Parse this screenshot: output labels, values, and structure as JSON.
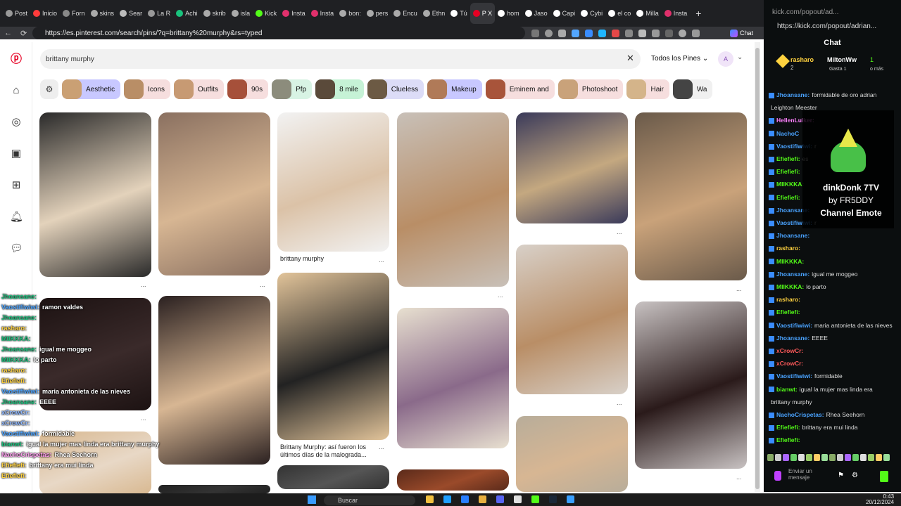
{
  "browser": {
    "tabs": [
      "Post",
      "Inicio",
      "Forn",
      "skins",
      "Sear",
      "La R",
      "Achi",
      "skrib",
      "isla",
      "Kick",
      "Insta",
      "Insta",
      "bon:",
      "pers",
      "Encu",
      "Ethn",
      "Tú",
      "P X",
      "hom",
      "Jaso",
      "Capi",
      "Cybi",
      "el co",
      "Milla",
      "Insta"
    ],
    "active_tab_index": 17,
    "url": "https://es.pinterest.com/search/pins/?q=brittany%20murphy&rs=typed",
    "chat_label": "Chat"
  },
  "pinterest": {
    "search_value": "brittany murphy",
    "all_pins_label": "Todos los Pines",
    "avatar_letter": "A",
    "filters": [
      "Aesthetic",
      "Icons",
      "Outfits",
      "90s",
      "Pfp",
      "8 mile",
      "Clueless",
      "Makeup",
      "Eminem and",
      "Photoshoot",
      "Hair",
      "Wa"
    ],
    "pin_labels": {
      "col3_pin1": "brittany murphy",
      "col3_pin2_line1": "Brittany Murphy: así fueron los",
      "col3_pin2_line2": "últimos días de la malograda..."
    },
    "dots": "..."
  },
  "overlay_chat": [
    {
      "user": "Jhoansane:",
      "text": ""
    },
    {
      "user": "Vaostifiwiwi:",
      "text": "ramon valdes"
    },
    {
      "user": "Jhoansane:",
      "text": ""
    },
    {
      "user": "rasharo:",
      "text": ""
    },
    {
      "user": "MIIKKKA:",
      "text": ""
    },
    {
      "user": "Jhoansane:",
      "text": "igual me moggeo"
    },
    {
      "user": "MIIKKKA:",
      "text": "lo parto"
    },
    {
      "user": "rasharo:",
      "text": ""
    },
    {
      "user": "Efiefiefi:",
      "text": ""
    },
    {
      "user": "Vaostifiwiwi:",
      "text": "maria antonieta de las nieves"
    },
    {
      "user": "Jhoansane:",
      "text": "EEEE"
    },
    {
      "user": "xCrowCr:",
      "text": ""
    },
    {
      "user": "xCrowCr:",
      "text": ""
    },
    {
      "user": "Vaostifiwiwi:",
      "text": "formidable"
    },
    {
      "user": "bianwt:",
      "text": "igual la mujer mas linda era brittany murphy"
    },
    {
      "user": "NachoCrispetas:",
      "text": "Rhea Seehorn"
    },
    {
      "user": "Efiefiefi:",
      "text": "brittany era mui linda"
    },
    {
      "user": "Efiefiefi:",
      "text": ""
    }
  ],
  "kick": {
    "window_title": "kick.com/popout/ad...",
    "url": "https://kick.com/popout/adrian...",
    "header": "Chat",
    "gift_user1": "rasharo",
    "gift_user1_count": "2",
    "gift_user2": "MiltonWw",
    "gift_user2_count": "1",
    "gift_text": "Gasta 1",
    "gift_more": "o más",
    "messages": [
      {
        "user": "Jhoansane:",
        "text": "formidable de oro adrian",
        "color": "#4aa3ff"
      },
      {
        "user": "",
        "text": "Leighton Meester",
        "color": "#ddd"
      },
      {
        "user": "HellenLulker:",
        "text": "",
        "color": "#ff80ff"
      },
      {
        "user": "NachoC",
        "text": "",
        "color": "#4aa3ff"
      },
      {
        "user": "Vaostifiwiwi:",
        "text": "r",
        "color": "#4aa3ff"
      },
      {
        "user": "Efiefiefi:",
        "text": "es",
        "color": "#53fc18"
      },
      {
        "user": "Efiefiefi:",
        "text": "",
        "color": "#53fc18"
      },
      {
        "user": "MIIKKKA:",
        "text": "",
        "color": "#53fc18"
      },
      {
        "user": "Efiefiefi:",
        "text": "",
        "color": "#53fc18"
      },
      {
        "user": "Jhoansane:",
        "text": "",
        "color": "#4aa3ff"
      },
      {
        "user": "Vaostifiwiwi:",
        "text": "r",
        "color": "#4aa3ff"
      },
      {
        "user": "Jhoansane:",
        "text": "",
        "color": "#4aa3ff"
      },
      {
        "user": "rasharo:",
        "text": "",
        "color": "#ffd23f"
      },
      {
        "user": "MIIKKKA:",
        "text": "",
        "color": "#53fc18"
      },
      {
        "user": "Jhoansane:",
        "text": "igual me moggeo",
        "color": "#4aa3ff"
      },
      {
        "user": "MIIKKKA:",
        "text": "lo parto",
        "color": "#53fc18"
      },
      {
        "user": "rasharo:",
        "text": "",
        "color": "#ffd23f"
      },
      {
        "user": "Efiefiefi:",
        "text": "",
        "color": "#53fc18"
      },
      {
        "user": "Vaostifiwiwi:",
        "text": "maria antonieta de las nieves",
        "color": "#4aa3ff"
      },
      {
        "user": "Jhoansane:",
        "text": "EEEE",
        "color": "#4aa3ff"
      },
      {
        "user": "xCrowCr:",
        "text": "",
        "color": "#ff5a5a"
      },
      {
        "user": "xCrowCr:",
        "text": "",
        "color": "#ff5a5a"
      },
      {
        "user": "Vaostifiwiwi:",
        "text": "formidable",
        "color": "#4aa3ff"
      },
      {
        "user": "bianwt:",
        "text": "igual la mujer mas linda era",
        "color": "#53fc18"
      },
      {
        "user": "",
        "text": "brittany murphy",
        "color": "#ddd"
      },
      {
        "user": "NachoCrispetas:",
        "text": "Rhea Seehorn",
        "color": "#4aa3ff"
      },
      {
        "user": "Efiefiefi:",
        "text": "brittany era mui linda",
        "color": "#53fc18"
      },
      {
        "user": "Efiefiefi:",
        "text": "",
        "color": "#53fc18"
      }
    ],
    "emote_name": "dinkDonk 7TV",
    "emote_by": "by FR5DDY",
    "emote_type": "Channel Emote",
    "input_placeholder": "Enviar un mensaje"
  },
  "taskbar": {
    "search_label": "Buscar",
    "time": "0:43",
    "date": "20/12/2024"
  },
  "colors": {
    "pinterest_red": "#e60023",
    "kick_green": "#53fc18",
    "kick_bg": "#0b0e0f"
  }
}
